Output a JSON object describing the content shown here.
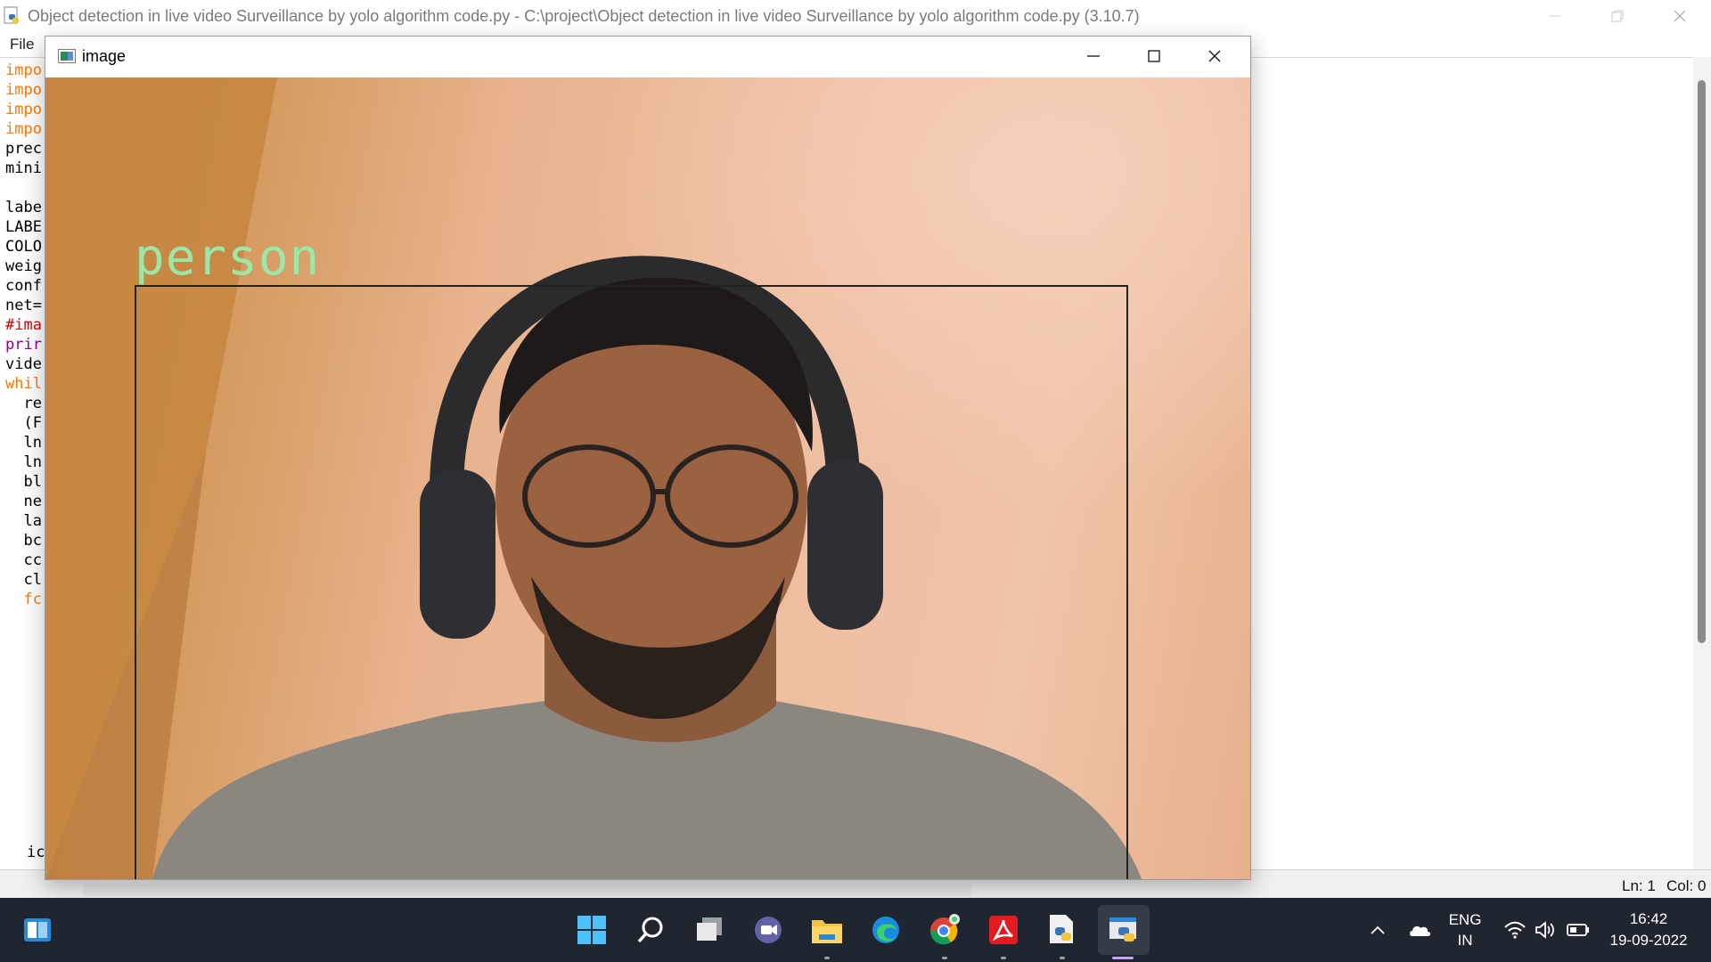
{
  "idle": {
    "title": "Object detection in live video Surveillance by yolo algorithm code.py - C:\\project\\Object detection in live video Surveillance by yolo algorithm code.py (3.10.7)",
    "menu": {
      "file": "File"
    },
    "code_fragments": [
      {
        "text": "impo",
        "color": "orange"
      },
      {
        "text": "impo",
        "color": "orange"
      },
      {
        "text": "impo",
        "color": "orange"
      },
      {
        "text": "impo",
        "color": "orange"
      },
      {
        "text": "prec",
        "color": "black"
      },
      {
        "text": "mini",
        "color": "black"
      },
      {
        "text": "",
        "color": "black"
      },
      {
        "text": "labe",
        "color": "black"
      },
      {
        "text": "LABE",
        "color": "black"
      },
      {
        "text": "COLO",
        "color": "black"
      },
      {
        "text": "weig",
        "color": "black"
      },
      {
        "text": "conf",
        "color": "black"
      },
      {
        "text": "net=",
        "color": "black"
      },
      {
        "text": "#ima",
        "color": "red"
      },
      {
        "text": "prir",
        "color": "purple"
      },
      {
        "text": "vide",
        "color": "black"
      },
      {
        "text": "whil",
        "color": "orange"
      },
      {
        "text": "  re",
        "color": "black"
      },
      {
        "text": "  (F",
        "color": "black"
      },
      {
        "text": "  ln",
        "color": "black"
      },
      {
        "text": "  ln",
        "color": "black"
      },
      {
        "text": "  bl",
        "color": "black"
      },
      {
        "text": "  ne",
        "color": "black"
      },
      {
        "text": "  la",
        "color": "black"
      },
      {
        "text": "  bc",
        "color": "black"
      },
      {
        "text": "  cc",
        "color": "black"
      },
      {
        "text": "  cl",
        "color": "black"
      },
      {
        "text": "  fc",
        "color": "orange"
      }
    ],
    "last_fragment": "ic",
    "status": {
      "ln": "Ln: 1",
      "col": "Col: 0"
    }
  },
  "cv_window": {
    "title": "image",
    "detection_label": "person"
  },
  "taskbar": {
    "tray": {
      "lang_top": "ENG",
      "lang_bottom": "IN",
      "time": "16:42",
      "date": "19-09-2022"
    }
  },
  "colors": {
    "taskbar_bg": "#1f2630",
    "label_green": "#9ce6a8",
    "idle_orange": "#ff7700",
    "idle_purple": "#900090"
  }
}
